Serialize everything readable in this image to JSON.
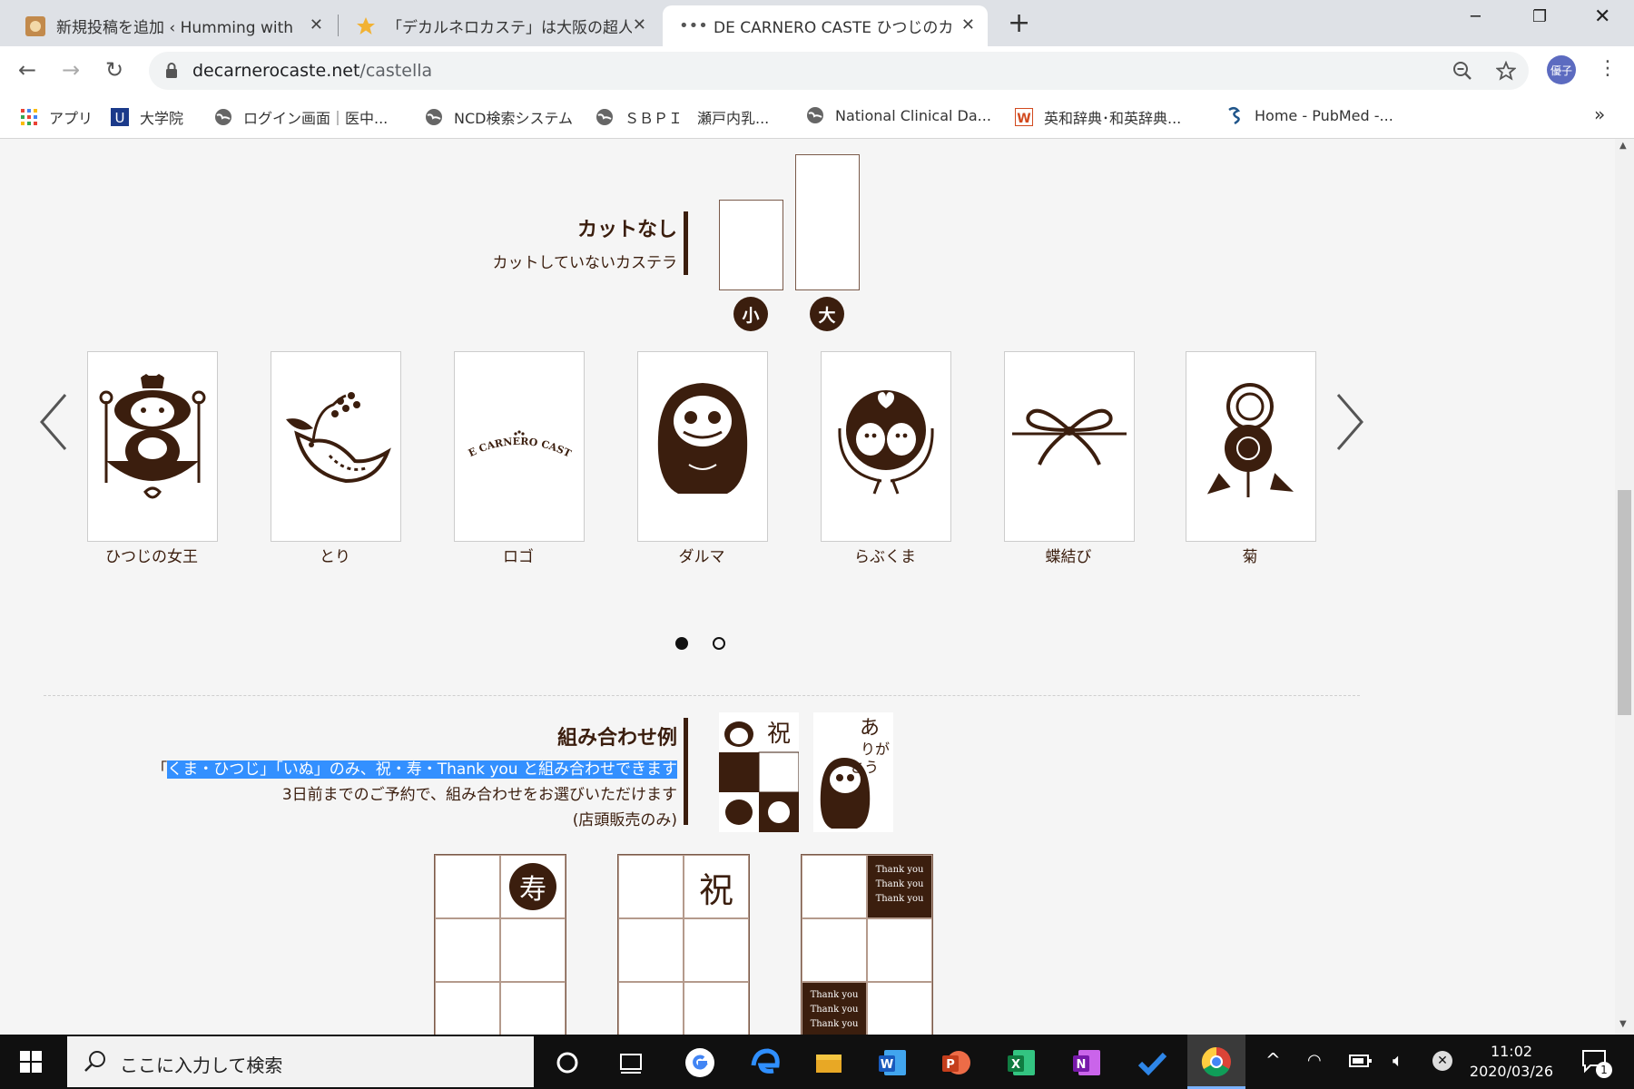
{
  "browser": {
    "tabs": [
      {
        "title": "新規投稿を追加 ‹ Humming with ",
        "active": false
      },
      {
        "title": "「デカルネロカステ」は大阪の超人気店",
        "active": false
      },
      {
        "title": "DE CARNERO CASTE ひつじのカステ",
        "active": true
      }
    ],
    "new_tab": "+",
    "url_host": "decarnerocaste.net",
    "url_path": "/castella",
    "profile_label": "優子",
    "bookmarks": [
      {
        "label": "アプリ",
        "icon": "apps-grid-icon"
      },
      {
        "label": "大学院",
        "icon": "university-icon"
      },
      {
        "label": "ログイン画面｜医中...",
        "icon": "globe-icon"
      },
      {
        "label": "NCD検索システム",
        "icon": "globe-icon"
      },
      {
        "label": "ＳＢＰＩ　瀬戸内乳...",
        "icon": "globe-icon"
      },
      {
        "label": "National Clinical Da...",
        "icon": "globe-icon"
      },
      {
        "label": "英和辞典･和英辞典...",
        "icon": "weblio-icon"
      },
      {
        "label": "Home - PubMed -...",
        "icon": "pubmed-icon"
      }
    ],
    "bookmarks_more": "»"
  },
  "page": {
    "cut": {
      "title": "カットなし",
      "subtitle": "カットしていないカステラ",
      "size_small": "小",
      "size_large": "大"
    },
    "carousel": {
      "items": [
        {
          "label": "ひつじの女王",
          "icon": "sheep-queen-icon"
        },
        {
          "label": "とり",
          "icon": "bird-icon"
        },
        {
          "label": "ロゴ",
          "icon": "logo-icon",
          "logo_text": "DE CARNERO CASTE"
        },
        {
          "label": "ダルマ",
          "icon": "daruma-icon"
        },
        {
          "label": "らぶくま",
          "icon": "love-bears-icon"
        },
        {
          "label": "蝶結び",
          "icon": "ribbon-bow-icon"
        },
        {
          "label": "菊",
          "icon": "chrysanthemum-icon"
        }
      ],
      "pages": 2,
      "current_page": 1
    },
    "combo": {
      "title": "組み合わせ例",
      "quote_open": "「",
      "line1_selected": "くま・ひつじ」「いぬ」のみ、祝・寿・Thank you と組み合わせできます",
      "line2": "3日前までのご予約で、組み合わせをお選びいただけます",
      "line3": "(店頭販売のみ)",
      "tile_iwai": "祝",
      "tile_kotobuki": "寿",
      "tile_arigatou": "あ\nりが\nとう",
      "thank_you": "Thank you\nThank you\nThank you"
    }
  },
  "taskbar": {
    "search_placeholder": "ここに入力して検索",
    "time": "11:02",
    "date": "2020/03/26",
    "notification_count": "1"
  },
  "colors": {
    "brand_brown": "#3b1e0e",
    "selection_blue": "#3390ff"
  }
}
